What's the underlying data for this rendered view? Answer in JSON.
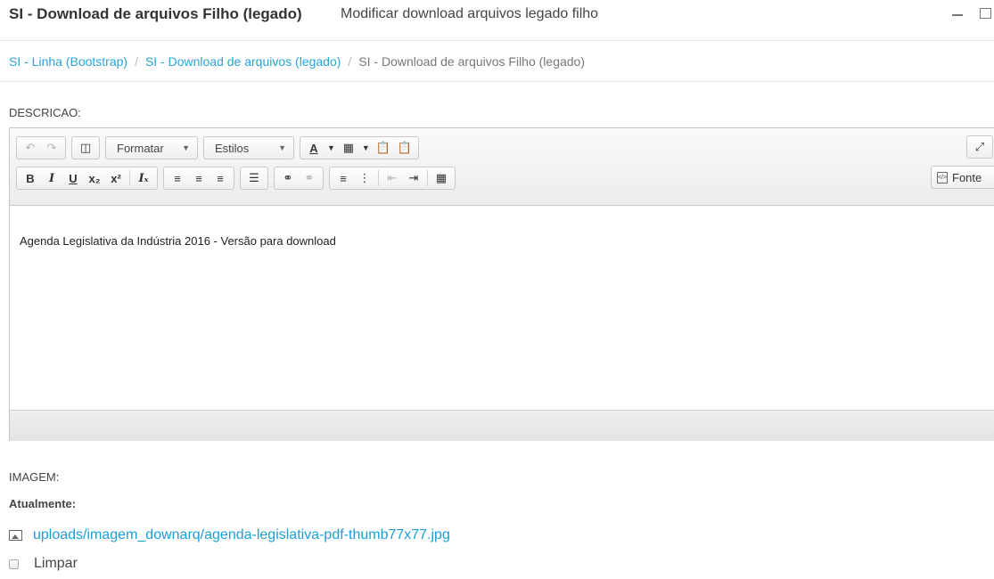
{
  "header": {
    "title": "SI - Download de arquivos Filho (legado)",
    "subtitle": "Modificar download arquivos legado filho"
  },
  "breadcrumb": {
    "items": [
      "SI - Linha (Bootstrap)",
      "SI - Download de arquivos (legado)"
    ],
    "separator": "/",
    "current": "SI - Download de arquivos Filho (legado)"
  },
  "form": {
    "descricao_label": "DESCRICAO:",
    "imagem_label": "IMAGEM:",
    "atualmente_label": "Atualmente:",
    "file_link": "uploads/imagem_downarq/agenda-legislativa-pdf-thumb77x77.jpg",
    "limpar_label": "Limpar"
  },
  "editor": {
    "format_label": "Formatar",
    "styles_label": "Estilos",
    "source_label": "Fonte",
    "content": "Agenda Legislativa da Indústria 2016 - Versão para download"
  },
  "colors": {
    "link": "#2aa3d6",
    "file_link": "#1a9fd8"
  }
}
